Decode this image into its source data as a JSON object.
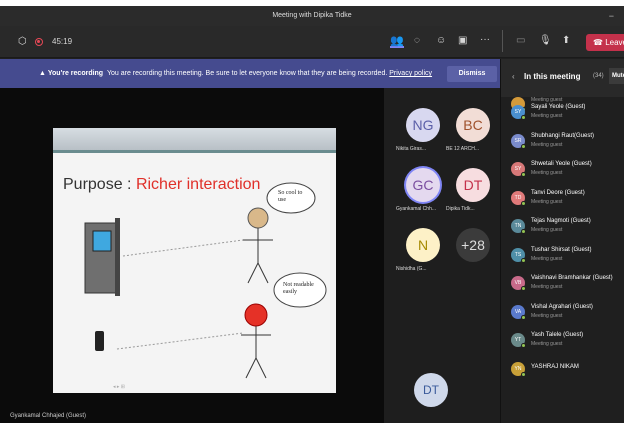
{
  "window": {
    "title": "Meeting with Dipika Tidke",
    "minimize_glyph": "−"
  },
  "controls": {
    "timer": "45:19",
    "leave_label": "Leave",
    "more_glyph": "···"
  },
  "banner": {
    "bold": "You're recording",
    "text": "You are recording this meeting. Be sure to let everyone know that they are being recorded.",
    "link": "Privacy policy",
    "dismiss": "Dismiss"
  },
  "slide": {
    "title_prefix": "Purpose : ",
    "title_highlight": "Richer interaction",
    "bubble1": "So cool to use",
    "bubble2": "Not readable easily"
  },
  "presenter": "Gyankamal Chhajed (Guest)",
  "tiles": [
    {
      "initials": "NG",
      "name": "Nikita Giras...",
      "bg": "#d8d8f0",
      "fg": "#5b5fa8"
    },
    {
      "initials": "BC",
      "name": "BE 12 ARCH...",
      "bg": "#f2ddd6",
      "fg": "#a0522d"
    },
    {
      "initials": "GC",
      "name": "Gyankamal Chh...",
      "bg": "#e4d9ef",
      "fg": "#7b4fa0"
    },
    {
      "initials": "DT",
      "name": "Dipika Tidk...",
      "bg": "#f7dde0",
      "fg": "#c4314b"
    },
    {
      "initials": "N",
      "name": "Nishidha (G...",
      "bg": "#fdf1c7",
      "fg": "#a68a00"
    },
    {
      "initials": "+28",
      "name": "",
      "bg": "#3b3b3b",
      "fg": "#ddd"
    }
  ],
  "self_tile": {
    "initials": "DT"
  },
  "panel": {
    "title": "In this meeting",
    "count": "(34)",
    "mute_all": "Mute all",
    "participants": [
      {
        "initials": "",
        "name": "",
        "role": "Meeting guest",
        "color": "#d49a3a"
      },
      {
        "initials": "SY",
        "name": "Sayali Yeole (Guest)",
        "role": "Meeting guest",
        "color": "#4a8fcf"
      },
      {
        "initials": "SR",
        "name": "Shubhangi Raut(Guest)",
        "role": "Meeting guest",
        "color": "#7a8bcc"
      },
      {
        "initials": "SY",
        "name": "Shwetali Yeole (Guest)",
        "role": "Meeting guest",
        "color": "#d77878"
      },
      {
        "initials": "TD",
        "name": "Tanvi Deore (Guest)",
        "role": "Meeting guest",
        "color": "#e07a7a"
      },
      {
        "initials": "TN",
        "name": "Tejas Nagmoti (Guest)",
        "role": "Meeting guest",
        "color": "#5a8a9a"
      },
      {
        "initials": "TS",
        "name": "Tushar Shirsat (Guest)",
        "role": "Meeting guest",
        "color": "#4f8fa8"
      },
      {
        "initials": "VB",
        "name": "Vaishnavi Bramhankar (Guest)",
        "role": "Meeting guest",
        "color": "#c86a8a"
      },
      {
        "initials": "VA",
        "name": "Vishal Agrahari (Guest)",
        "role": "Meeting guest",
        "color": "#5a7acc"
      },
      {
        "initials": "YT",
        "name": "Yash Talele (Guest)",
        "role": "Meeting guest",
        "color": "#6a8a8a"
      },
      {
        "initials": "YN",
        "name": "YASHRAJ NIKAM",
        "role": "",
        "color": "#c8a038"
      }
    ]
  }
}
